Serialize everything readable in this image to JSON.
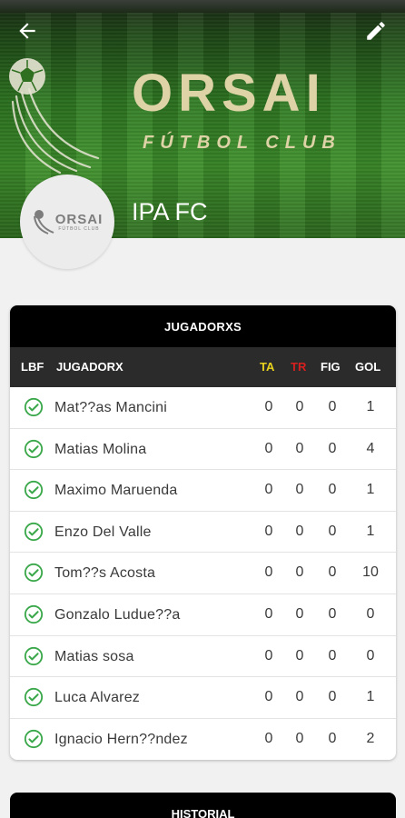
{
  "header": {
    "brand_title": "ORSAI",
    "brand_subtitle": "FÚTBOL CLUB",
    "team_name": "IPA FC",
    "back_icon": "arrow-left-icon",
    "edit_icon": "pencil-icon"
  },
  "avatar": {
    "word": "ORSAI",
    "sub": "FÚTBOL CLUB"
  },
  "players_card": {
    "title": "JUGADORXS",
    "columns": {
      "lbf": "LBF",
      "player": "JUGADORX",
      "ta": "TA",
      "tr": "TR",
      "fig": "FIG",
      "gol": "GOL"
    },
    "rows": [
      {
        "name": "Mat??as Mancini",
        "ta": "0",
        "tr": "0",
        "fig": "0",
        "gol": "1"
      },
      {
        "name": "Matias Molina",
        "ta": "0",
        "tr": "0",
        "fig": "0",
        "gol": "4"
      },
      {
        "name": "Maximo Maruenda",
        "ta": "0",
        "tr": "0",
        "fig": "0",
        "gol": "1"
      },
      {
        "name": "Enzo Del Valle",
        "ta": "0",
        "tr": "0",
        "fig": "0",
        "gol": "1"
      },
      {
        "name": "Tom??s Acosta",
        "ta": "0",
        "tr": "0",
        "fig": "0",
        "gol": "10"
      },
      {
        "name": "Gonzalo Ludue??a",
        "ta": "0",
        "tr": "0",
        "fig": "0",
        "gol": "0"
      },
      {
        "name": "Matias sosa",
        "ta": "0",
        "tr": "0",
        "fig": "0",
        "gol": "0"
      },
      {
        "name": "Luca Alvarez",
        "ta": "0",
        "tr": "0",
        "fig": "0",
        "gol": "1"
      },
      {
        "name": "Ignacio Hern??ndez",
        "ta": "0",
        "tr": "0",
        "fig": "0",
        "gol": "2"
      }
    ]
  },
  "history_card": {
    "title": "HISTORIAL"
  },
  "colors": {
    "ta": "#e8d21d",
    "tr": "#d81f1f",
    "check": "#3aa84a",
    "brand_gold": "#ded3a6"
  }
}
